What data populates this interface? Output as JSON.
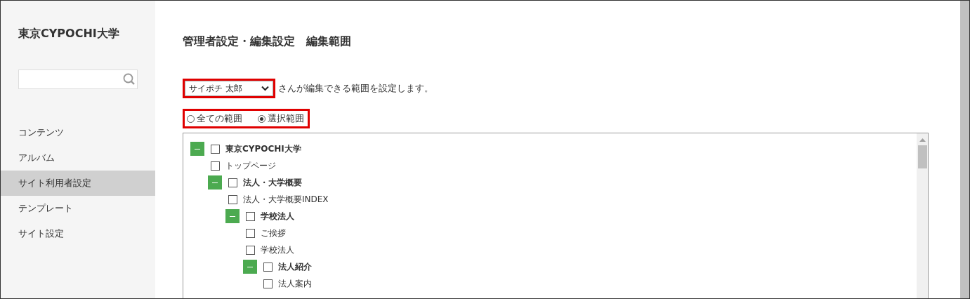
{
  "sidebar": {
    "site_title": "東京CYPOCHI大学",
    "items": [
      {
        "label": "コンテンツ",
        "selected": false
      },
      {
        "label": "アルバム",
        "selected": false
      },
      {
        "label": "サイト利用者設定",
        "selected": true
      },
      {
        "label": "テンプレート",
        "selected": false
      },
      {
        "label": "サイト設定",
        "selected": false
      }
    ]
  },
  "page_title": "管理者設定・編集設定　編集範囲",
  "user_select": {
    "value": "サイポチ 太郎",
    "suffix": "さんが編集できる範囲を設定します。",
    "highlighted": true
  },
  "scope": {
    "highlighted": true,
    "options": [
      {
        "label": "全ての範囲",
        "selected": false
      },
      {
        "label": "選択範囲",
        "selected": true
      }
    ]
  },
  "tree": [
    {
      "label": "東京CYPOCHI大学",
      "checked": false,
      "expanded": true,
      "children": [
        {
          "label": "トップページ",
          "checked": false
        },
        {
          "label": "法人・大学概要",
          "checked": false,
          "expanded": true,
          "children": [
            {
              "label": "法人・大学概要INDEX",
              "checked": false
            },
            {
              "label": "学校法人",
              "checked": false,
              "expanded": true,
              "children": [
                {
                  "label": "ご挨拶",
                  "checked": false
                },
                {
                  "label": "学校法人",
                  "checked": false
                },
                {
                  "label": "法人紹介",
                  "checked": false,
                  "expanded": true,
                  "children": [
                    {
                      "label": "法人案内",
                      "checked": false
                    }
                  ]
                }
              ]
            }
          ]
        }
      ]
    }
  ]
}
